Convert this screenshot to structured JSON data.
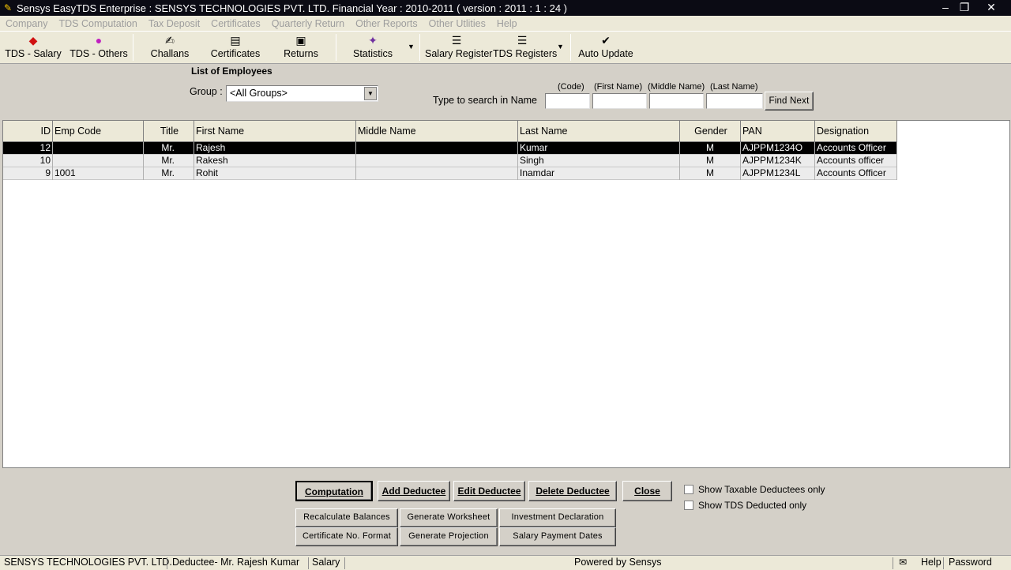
{
  "window": {
    "title": "Sensys EasyTDS Enterprise : SENSYS TECHNOLOGIES PVT. LTD. Financial Year : 2010-2011 ( version : 2011 : 1 : 24 )"
  },
  "menu": [
    "Company",
    "TDS Computation",
    "Tax Deposit",
    "Certificates",
    "Quarterly Return",
    "Other Reports",
    "Other Utlities",
    "Help"
  ],
  "toolbar": {
    "tds_salary": "TDS - Salary",
    "tds_others": "TDS - Others",
    "challans": "Challans",
    "certificates": "Certificates",
    "returns": "Returns",
    "statistics": "Statistics",
    "salary_register": "Salary Register",
    "tds_registers": "TDS Registers",
    "auto_update": "Auto Update"
  },
  "panel": {
    "title": "List of Employees",
    "group_label": "Group :",
    "group_value": "<All Groups>",
    "search_label": "Type to search in Name",
    "code_hdr": "(Code)",
    "first_hdr": "(First Name)",
    "middle_hdr": "(Middle Name)",
    "last_hdr": "(Last Name)",
    "find_next": "Find Next"
  },
  "table": {
    "headers": [
      "ID",
      "Emp Code",
      "Title",
      "First Name",
      "Middle Name",
      "Last Name",
      "Gender",
      "PAN",
      "Designation"
    ],
    "rows": [
      [
        "12",
        "",
        "Mr.",
        "Rajesh",
        "",
        "Kumar",
        "M",
        "AJPPM1234O",
        "Accounts Officer"
      ],
      [
        "10",
        "",
        "Mr.",
        "Rakesh",
        "",
        "Singh",
        "M",
        "AJPPM1234K",
        "Accounts officer"
      ],
      [
        "9",
        "1001",
        "Mr.",
        "Rohit",
        "",
        "Inamdar",
        "M",
        "AJPPM1234L",
        "Accounts Officer"
      ]
    ]
  },
  "buttons": {
    "computation": "Computation",
    "add": "Add Deductee",
    "edit": "Edit Deductee",
    "delete": "Delete Deductee",
    "close": "Close",
    "recalc": "Recalculate Balances",
    "gen_ws": "Generate Worksheet",
    "inv_decl": "Investment Declaration",
    "cert_fmt": "Certificate No. Format",
    "gen_proj": "Generate Projection",
    "sal_dates": "Salary Payment Dates"
  },
  "checks": {
    "taxable": "Show Taxable Deductees only",
    "tds": "Show TDS Deducted only"
  },
  "status": {
    "company": "SENSYS TECHNOLOGIES PVT. LTD.",
    "deductee": "Deductee- Mr. Rajesh  Kumar",
    "mode": "Salary",
    "powered": "Powered by Sensys",
    "help": "Help",
    "password": "Password"
  }
}
